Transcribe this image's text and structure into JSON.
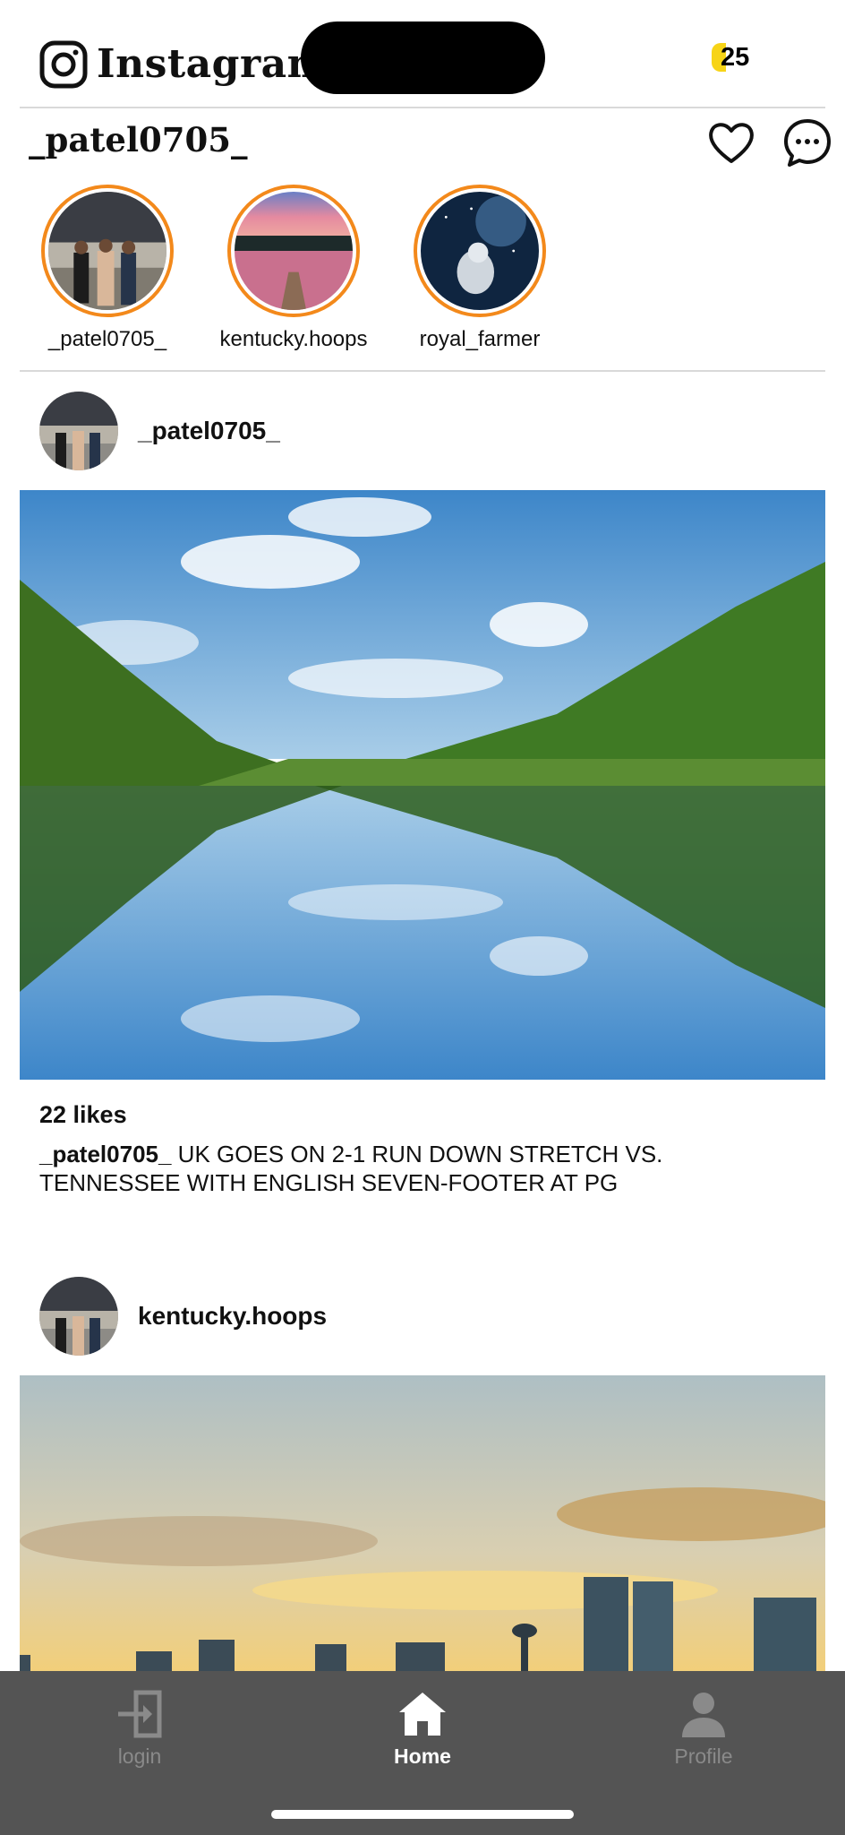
{
  "app": {
    "title": "Instagram",
    "battery": "25"
  },
  "header": {
    "username": "_patel0705_"
  },
  "icons": {
    "logo": "instagram-camera-icon",
    "heart": "heart-icon",
    "messages": "message-bubble-icon",
    "login": "login-icon",
    "home": "home-icon",
    "profile": "person-icon"
  },
  "stories": [
    {
      "username": "_patel0705_"
    },
    {
      "username": "kentucky.hoops"
    },
    {
      "username": "royal_farmer"
    }
  ],
  "posts": [
    {
      "username": "_patel0705_",
      "likes": "22 likes",
      "caption_user": "_patel0705_",
      "caption_text": " UK GOES ON 2-1 RUN DOWN STRETCH VS. TENNESSEE WITH ENGLISH SEVEN-FOOTER AT PG"
    },
    {
      "username": "kentucky.hoops"
    }
  ],
  "nav": {
    "login": "login",
    "home": "Home",
    "profile": "Profile"
  },
  "colors": {
    "story_ring": "#f3891b",
    "nav_bg": "#545454",
    "battery": "#f7d417"
  }
}
